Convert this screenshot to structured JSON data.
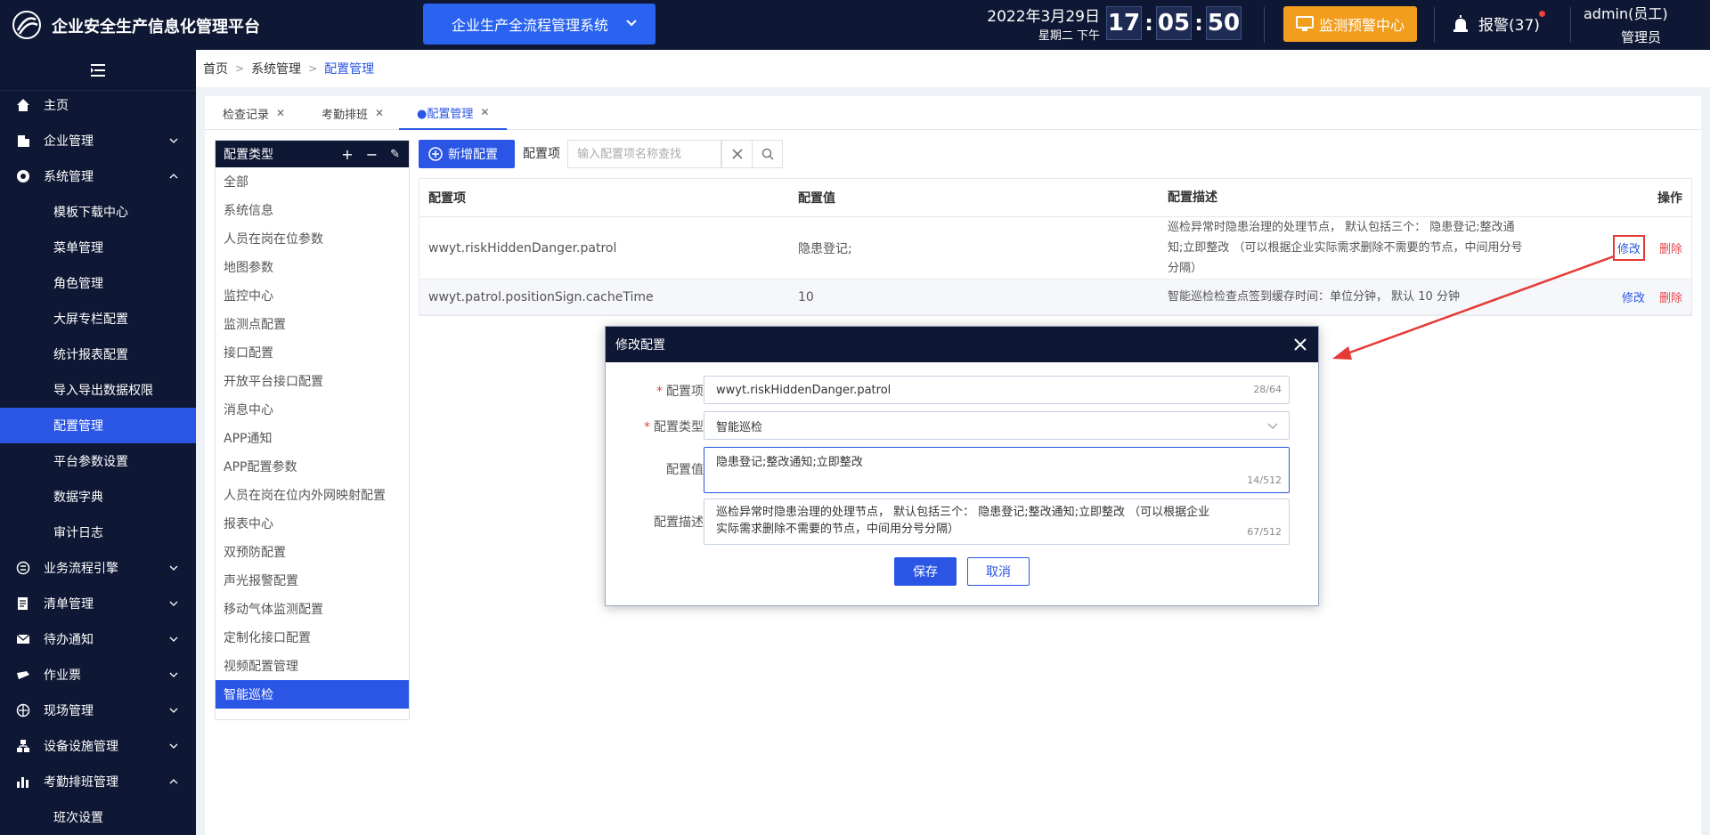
{
  "header": {
    "app_title": "企业安全生产信息化管理平台",
    "system_select": "企业生产全流程管理系统",
    "date": "2022年3月29日",
    "weekday": "星期二  下午",
    "clock": {
      "hour": "17",
      "minute": "05",
      "second": "50"
    },
    "monitor_button": "监测预警中心",
    "alarm": "报警(37)",
    "user_name": "admin(员工)",
    "user_role": "管理员",
    "colors": {
      "bg": "#0e1733",
      "accent": "#2a55e5",
      "monitor": "#f29d1c",
      "alarm_dot": "#f03e3e"
    }
  },
  "sidebar": {
    "items": [
      {
        "label": "主页",
        "icon": "home-icon"
      },
      {
        "label": "企业管理",
        "icon": "building-icon"
      },
      {
        "label": "系统管理",
        "icon": "settings-icon"
      },
      {
        "label": "模板下载中心"
      },
      {
        "label": "菜单管理"
      },
      {
        "label": "角色管理"
      },
      {
        "label": "大屏专栏配置"
      },
      {
        "label": "统计报表配置"
      },
      {
        "label": "导入导出数据权限"
      },
      {
        "label": "配置管理",
        "active": true
      },
      {
        "label": "平台参数设置"
      },
      {
        "label": "数据字典"
      },
      {
        "label": "审计日志"
      },
      {
        "label": "业务流程引擎",
        "icon": "workflow-icon"
      },
      {
        "label": "清单管理",
        "icon": "list-icon"
      },
      {
        "label": "待办通知",
        "icon": "mail-icon"
      },
      {
        "label": "作业票",
        "icon": "ticket-icon"
      },
      {
        "label": "现场管理",
        "icon": "site-icon"
      },
      {
        "label": "设备设施管理",
        "icon": "equipment-icon"
      },
      {
        "label": "考勤排班管理",
        "icon": "chart-icon"
      },
      {
        "label": "班次设置"
      }
    ]
  },
  "breadcrumb": [
    "首页",
    "系统管理",
    "配置管理"
  ],
  "tabs": [
    {
      "label": "检查记录"
    },
    {
      "label": "考勤排班"
    },
    {
      "label": "●配置管理",
      "active": true
    }
  ],
  "types_panel": {
    "title": "配置类型",
    "ops": [
      "+",
      "−",
      "✎"
    ],
    "items": [
      "全部",
      "系统信息",
      "人员在岗在位参数",
      "地图参数",
      "监控中心",
      "监测点配置",
      "接口配置",
      "开放平台接口配置",
      "消息中心",
      "APP通知",
      "APP配置参数",
      "人员在岗在位内外网映射配置",
      "报表中心",
      "双预防配置",
      "声光报警配置",
      "移动气体监测配置",
      "定制化接口配置",
      "视频配置管理",
      "智能巡检"
    ],
    "active": "智能巡检"
  },
  "toolbar": {
    "add_label": "新增配置",
    "search_label": "配置项",
    "search_placeholder": "输入配置项名称查找"
  },
  "table": {
    "headers": [
      "配置项",
      "配置值",
      "配置描述",
      "操作"
    ],
    "rows": [
      {
        "key": "wwyt.riskHiddenDanger.patrol",
        "value": "隐患登记;",
        "desc": "巡检异常时隐患治理的处理节点， 默认包括三个： 隐患登记;整改通知;立即整改 （可以根据企业实际需求删除不需要的节点，中间用分号分隔）",
        "edit": "修改",
        "delete": "删除"
      },
      {
        "key": "wwyt.patrol.positionSign.cacheTime",
        "value": "10",
        "desc": "智能巡检检查点签到缓存时间：单位分钟， 默认 10 分钟",
        "edit": "修改",
        "delete": "删除"
      }
    ]
  },
  "dialog": {
    "title": "修改配置",
    "fields": {
      "key": {
        "label": "配置项",
        "required": true,
        "value": "wwyt.riskHiddenDanger.patrol",
        "counter": "28/64"
      },
      "type": {
        "label": "配置类型",
        "required": true,
        "value": "智能巡检"
      },
      "value": {
        "label": "配置值",
        "required": false,
        "value": "隐患登记;整改通知;立即整改",
        "counter": "14/512"
      },
      "desc": {
        "label": "配置描述",
        "required": false,
        "value": "巡检异常时隐患治理的处理节点， 默认包括三个： 隐患登记;整改通知;立即整改 （可以根据企业实际需求删除不需要的节点，中间用分号分隔）",
        "counter": "67/512"
      }
    },
    "save": "保存",
    "cancel": "取消"
  }
}
